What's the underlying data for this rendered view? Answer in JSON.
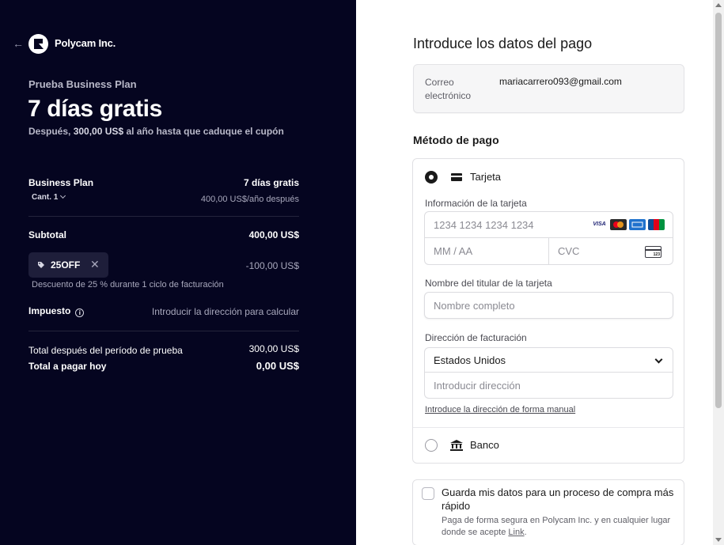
{
  "summary": {
    "brand": "Polycam Inc.",
    "plan_label": "Prueba Business Plan",
    "trial_title": "7 días gratis",
    "after_prefix": "Después,",
    "after_amount": "300,00 US$",
    "after_suffix": "al año hasta que caduque el cupón",
    "line_item": {
      "name": "Business Plan",
      "qty_label": "Cant. 1",
      "price": "7 días gratis",
      "price_after": "400,00 US$/año después"
    },
    "subtotal_label": "Subtotal",
    "subtotal_value": "400,00 US$",
    "coupon": {
      "code": "25OFF",
      "discount": "-100,00 US$",
      "description": "Descuento de 25 % durante 1 ciclo de facturación"
    },
    "tax_label": "Impuesto",
    "tax_value": "Introducir la dirección para calcular",
    "total_after_label": "Total después del período de prueba",
    "total_after_value": "300,00 US$",
    "total_today_label": "Total a pagar hoy",
    "total_today_value": "0,00 US$"
  },
  "payment": {
    "title": "Introduce los datos del pago",
    "email_label": "Correo electrónico",
    "email_value": "mariacarrero093@gmail.com",
    "method_title": "Método de pago",
    "card": {
      "label": "Tarjeta",
      "info_label": "Información de la tarjeta",
      "number_placeholder": "1234 1234 1234 1234",
      "expiry_placeholder": "MM / AA",
      "cvc_placeholder": "CVC",
      "cvc_icon_text": "123",
      "brands": [
        "VISA",
        "Mastercard",
        "AMEX",
        "JCB"
      ],
      "visa_text": "VISA",
      "holder_label": "Nombre del titular de la tarjeta",
      "holder_placeholder": "Nombre completo",
      "billing_label": "Dirección de facturación",
      "country_value": "Estados Unidos",
      "address_placeholder": "Introducir dirección",
      "manual_link": "Introduce la dirección de forma manual"
    },
    "bank_label": "Banco",
    "save": {
      "title": "Guarda mis datos para un proceso de compra más rápido",
      "desc_prefix": "Paga de forma segura en Polycam Inc. y en cualquier lugar donde se acepte ",
      "desc_link": "Link",
      "desc_suffix": "."
    }
  }
}
